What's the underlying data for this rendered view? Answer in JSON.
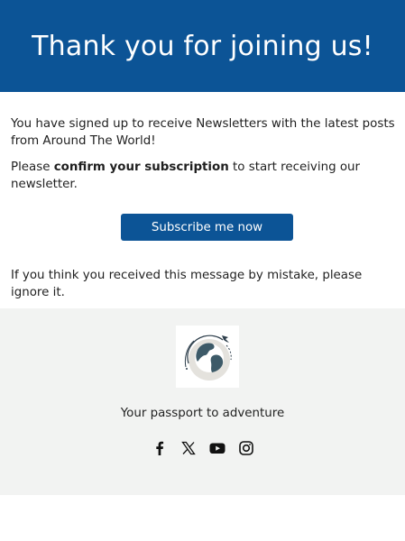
{
  "header": {
    "title": "Thank you for joining us!"
  },
  "body": {
    "intro": "You have signed up to receive Newsletters with the latest posts from Around The World!",
    "confirm_prefix": "Please ",
    "confirm_bold": "confirm your subscription",
    "confirm_suffix": " to start receiving our newsletter.",
    "button_label": "Subscribe me now",
    "ignore_text": "If you think you received this message by mistake, please ignore it."
  },
  "footer": {
    "tagline": "Your passport to adventure",
    "social": [
      {
        "icon": "facebook-icon"
      },
      {
        "icon": "x-icon"
      },
      {
        "icon": "youtube-icon"
      },
      {
        "icon": "instagram-icon"
      }
    ]
  },
  "colors": {
    "brand": "#0c5496",
    "footer_bg": "#f2f3f2",
    "globe": "#3d5a68"
  }
}
